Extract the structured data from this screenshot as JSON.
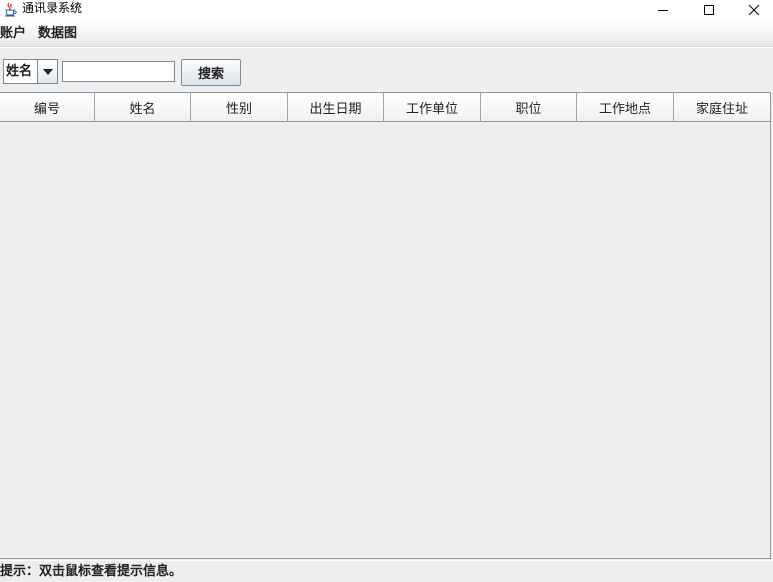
{
  "window": {
    "title": "通讯录系统",
    "icon": "java-cup-icon"
  },
  "menubar": {
    "items": [
      {
        "label": "账户"
      },
      {
        "label": "数据图"
      }
    ]
  },
  "search": {
    "field_select": {
      "selected": "姓名",
      "options": [
        "姓名"
      ]
    },
    "query_value": "",
    "button_label": "搜索"
  },
  "table": {
    "columns": [
      "编号",
      "姓名",
      "性别",
      "出生日期",
      "工作单位",
      "职位",
      "工作地点",
      "家庭住址"
    ],
    "rows": []
  },
  "status": {
    "hint": "提示：双击鼠标查看提示信息。"
  },
  "colors": {
    "background": "#eeeeee",
    "border": "#7a8a99",
    "button_gradient_bottom": "#dce4ee"
  }
}
